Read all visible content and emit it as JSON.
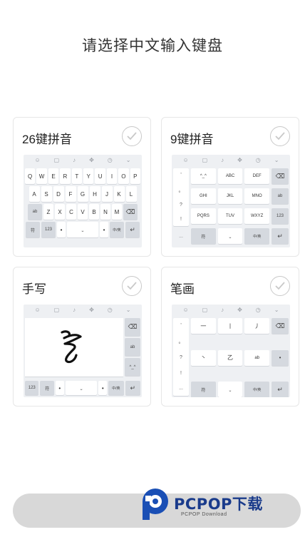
{
  "page": {
    "title": "请选择中文输入键盘"
  },
  "toolbar_icons": [
    "☺",
    "▢",
    "♪",
    "✥",
    "◷",
    "⌄"
  ],
  "cards": {
    "pinyin26": {
      "title": "26键拼音",
      "rows": [
        [
          "Q",
          "W",
          "E",
          "R",
          "T",
          "Y",
          "U",
          "I",
          "O",
          "P"
        ],
        [
          "A",
          "S",
          "D",
          "F",
          "G",
          "H",
          "J",
          "K",
          "L"
        ],
        [
          "ab",
          "Z",
          "X",
          "C",
          "V",
          "B",
          "N",
          "M",
          "⌫"
        ],
        [
          "符",
          "123",
          "•",
          "⎵",
          "•",
          "中/英",
          "↵"
        ]
      ]
    },
    "pinyin9": {
      "title": "9键拼音",
      "punct": [
        "'",
        "。",
        "?",
        "!",
        "..."
      ],
      "keys": [
        "^_^",
        "ABC",
        "DEF",
        "GHI",
        "JKL",
        "MNO",
        "PQRS",
        "TUV",
        "WXYZ"
      ],
      "side": [
        "⌫",
        "ab",
        "123",
        "↵"
      ],
      "bottom": [
        "符",
        "⎵",
        "中/英"
      ]
    },
    "handwriting": {
      "title": "手写",
      "side": [
        "⌫",
        "ab",
        "^_^"
      ],
      "bottom": [
        "123",
        "符",
        "•",
        "⎵",
        "•",
        "中/英",
        "↵"
      ]
    },
    "stroke": {
      "title": "笔画",
      "punct": [
        "'",
        "。",
        "?",
        "!",
        "..."
      ],
      "keys": [
        "一",
        "丨",
        "丿",
        "丶",
        "乙",
        "ab"
      ],
      "side": [
        "⌫",
        "•",
        "123",
        "↵"
      ],
      "bottom": [
        "符",
        "⎵",
        "中/英"
      ]
    }
  },
  "watermark": {
    "brand": "PCPOP下载",
    "sub": "PCPOP Download"
  }
}
